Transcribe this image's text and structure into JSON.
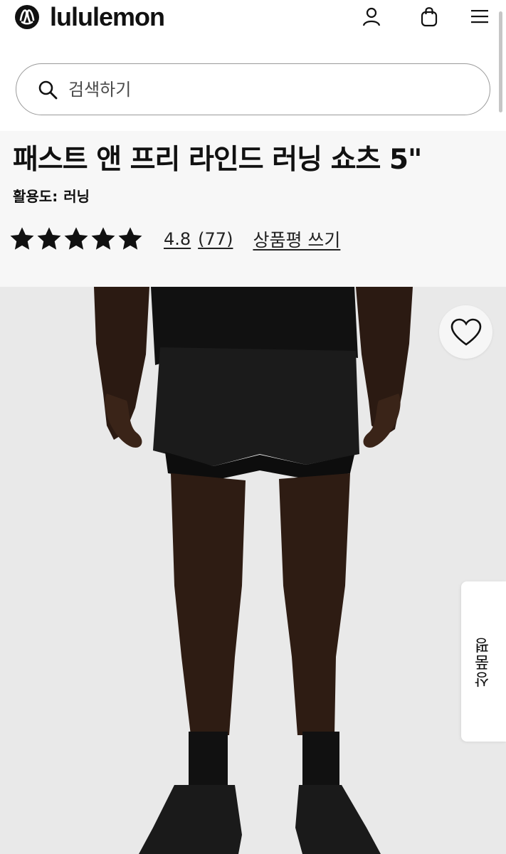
{
  "header": {
    "brand": "lululemon",
    "icons": [
      "account-icon",
      "shopping-bag-icon",
      "menu-icon"
    ]
  },
  "search": {
    "placeholder": "검색하기"
  },
  "product": {
    "title": "패스트 앤 프리 라인드 러닝 쇼츠 5\"",
    "activity_label": "활용도:",
    "activity_value": "러닝",
    "rating": 4.8,
    "rating_text": "4.8",
    "review_count_text": "(77)",
    "stars_filled": 5,
    "stars_total": 5,
    "write_review": "상품평 쓰기"
  },
  "gallery": {
    "wishlist_icon": "heart-icon",
    "review_tab_label": "상품평"
  },
  "colors": {
    "text": "#111111",
    "info_bg": "#f7f7f7",
    "image_bg": "#e9e9e9",
    "search_border": "#9a9a9a"
  }
}
